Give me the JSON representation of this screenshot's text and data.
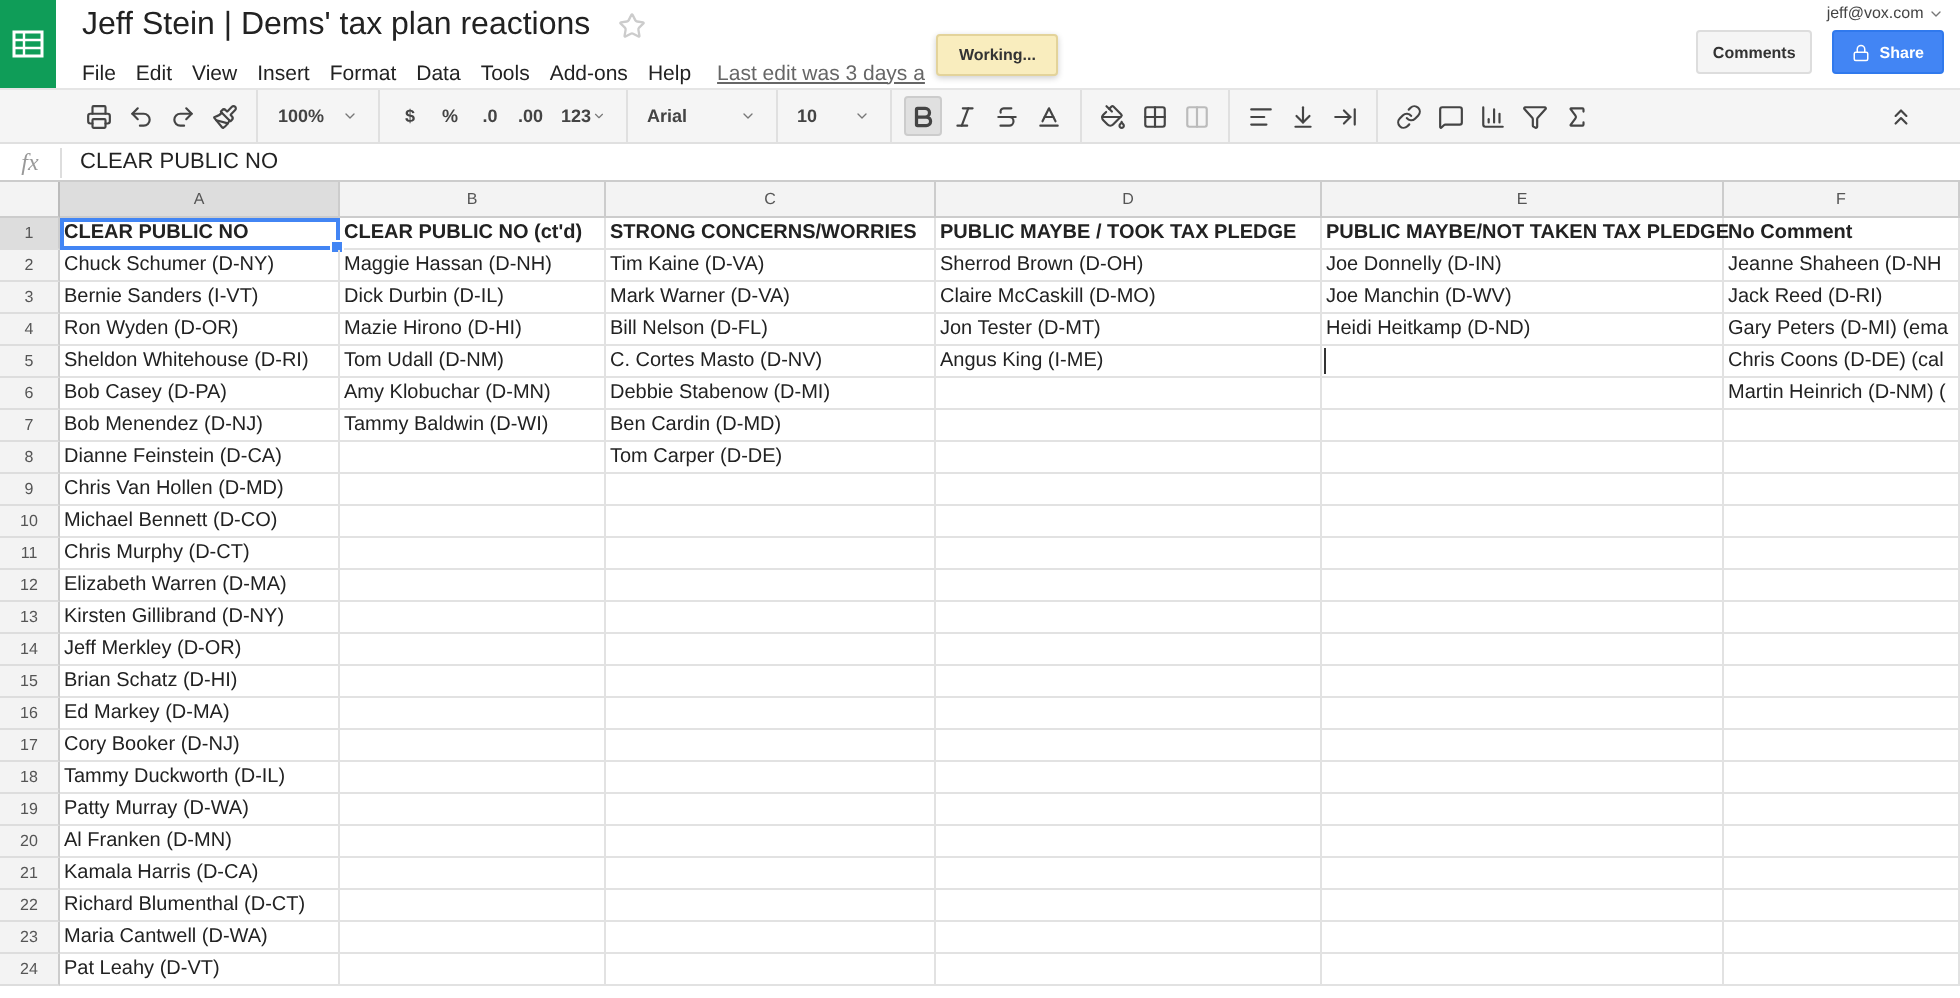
{
  "document": {
    "title": "Jeff Stein | Dems' tax plan reactions",
    "starred": false
  },
  "account": {
    "email": "jeff@vox.com"
  },
  "menu": [
    "File",
    "Edit",
    "View",
    "Insert",
    "Format",
    "Data",
    "Tools",
    "Add-ons",
    "Help"
  ],
  "last_edit": "Last edit was 3 days a",
  "toast": "Working...",
  "buttons": {
    "comments": "Comments",
    "share": "Share"
  },
  "toolbar": {
    "zoom": "100%",
    "currency": "$",
    "percent": "%",
    "decimal_less": ".0",
    "decimal_more": ".00",
    "format": "123",
    "font": "Arial",
    "font_size": "10",
    "bold_active": true
  },
  "formula_bar": {
    "label": "fx",
    "value": "CLEAR PUBLIC NO"
  },
  "columns": [
    {
      "label": "A",
      "selected": true
    },
    {
      "label": "B",
      "selected": false
    },
    {
      "label": "C",
      "selected": false
    },
    {
      "label": "D",
      "selected": false
    },
    {
      "label": "E",
      "selected": false
    },
    {
      "label": "F",
      "selected": false
    }
  ],
  "rows": [
    {
      "number": "1",
      "selected": true,
      "header": true,
      "cells": [
        "CLEAR PUBLIC NO",
        "CLEAR PUBLIC NO (ct'd)",
        "STRONG CONCERNS/WORRIES",
        "PUBLIC MAYBE / TOOK TAX PLEDGE",
        "PUBLIC MAYBE/NOT TAKEN TAX PLEDGE",
        "No Comment"
      ]
    },
    {
      "number": "2",
      "selected": false,
      "header": false,
      "cells": [
        "Chuck Schumer (D-NY)",
        "Maggie Hassan (D-NH)",
        "Tim Kaine (D-VA)",
        "Sherrod Brown (D-OH)",
        "Joe Donnelly (D-IN)",
        "Jeanne Shaheen (D-NH"
      ]
    },
    {
      "number": "3",
      "selected": false,
      "header": false,
      "cells": [
        "Bernie Sanders (I-VT)",
        "Dick Durbin (D-IL)",
        "Mark Warner (D-VA)",
        "Claire McCaskill (D-MO)",
        "Joe Manchin (D-WV)",
        "Jack Reed (D-RI)"
      ]
    },
    {
      "number": "4",
      "selected": false,
      "header": false,
      "cells": [
        "Ron Wyden (D-OR)",
        "Mazie Hirono (D-HI)",
        "Bill Nelson (D-FL)",
        "Jon Tester (D-MT)",
        "Heidi Heitkamp (D-ND)",
        "Gary Peters (D-MI) (ema"
      ]
    },
    {
      "number": "5",
      "selected": false,
      "header": false,
      "cells": [
        "Sheldon Whitehouse (D-RI)",
        "Tom Udall (D-NM)",
        "C. Cortes Masto (D-NV)",
        "Angus King (I-ME)",
        "",
        "Chris Coons (D-DE) (cal"
      ]
    },
    {
      "number": "6",
      "selected": false,
      "header": false,
      "cells": [
        "Bob Casey (D-PA)",
        "Amy Klobuchar (D-MN)",
        "Debbie Stabenow (D-MI)",
        "",
        "",
        "Martin Heinrich (D-NM) ("
      ]
    },
    {
      "number": "7",
      "selected": false,
      "header": false,
      "cells": [
        "Bob Menendez (D-NJ)",
        "Tammy Baldwin (D-WI)",
        "Ben Cardin (D-MD)",
        "",
        "",
        ""
      ]
    },
    {
      "number": "8",
      "selected": false,
      "header": false,
      "cells": [
        "Dianne Feinstein (D-CA)",
        "",
        "Tom Carper (D-DE)",
        "",
        "",
        ""
      ]
    },
    {
      "number": "9",
      "selected": false,
      "header": false,
      "cells": [
        "Chris Van Hollen (D-MD)",
        "",
        "",
        "",
        "",
        ""
      ]
    },
    {
      "number": "10",
      "selected": false,
      "header": false,
      "cells": [
        "Michael Bennett (D-CO)",
        "",
        "",
        "",
        "",
        ""
      ]
    },
    {
      "number": "11",
      "selected": false,
      "header": false,
      "cells": [
        "Chris Murphy (D-CT)",
        "",
        "",
        "",
        "",
        ""
      ]
    },
    {
      "number": "12",
      "selected": false,
      "header": false,
      "cells": [
        "Elizabeth Warren (D-MA)",
        "",
        "",
        "",
        "",
        ""
      ]
    },
    {
      "number": "13",
      "selected": false,
      "header": false,
      "cells": [
        "Kirsten Gillibrand (D-NY)",
        "",
        "",
        "",
        "",
        ""
      ]
    },
    {
      "number": "14",
      "selected": false,
      "header": false,
      "cells": [
        "Jeff Merkley (D-OR)",
        "",
        "",
        "",
        "",
        ""
      ]
    },
    {
      "number": "15",
      "selected": false,
      "header": false,
      "cells": [
        "Brian Schatz (D-HI)",
        "",
        "",
        "",
        "",
        ""
      ]
    },
    {
      "number": "16",
      "selected": false,
      "header": false,
      "cells": [
        "Ed Markey (D-MA)",
        "",
        "",
        "",
        "",
        ""
      ]
    },
    {
      "number": "17",
      "selected": false,
      "header": false,
      "cells": [
        "Cory Booker (D-NJ)",
        "",
        "",
        "",
        "",
        ""
      ]
    },
    {
      "number": "18",
      "selected": false,
      "header": false,
      "cells": [
        "Tammy Duckworth (D-IL)",
        "",
        "",
        "",
        "",
        ""
      ]
    },
    {
      "number": "19",
      "selected": false,
      "header": false,
      "cells": [
        "Patty Murray (D-WA)",
        "",
        "",
        "",
        "",
        ""
      ]
    },
    {
      "number": "20",
      "selected": false,
      "header": false,
      "cells": [
        "Al Franken (D-MN)",
        "",
        "",
        "",
        "",
        ""
      ]
    },
    {
      "number": "21",
      "selected": false,
      "header": false,
      "cells": [
        "Kamala Harris (D-CA)",
        "",
        "",
        "",
        "",
        ""
      ]
    },
    {
      "number": "22",
      "selected": false,
      "header": false,
      "cells": [
        "Richard Blumenthal (D-CT)",
        "",
        "",
        "",
        "",
        ""
      ]
    },
    {
      "number": "23",
      "selected": false,
      "header": false,
      "cells": [
        "Maria Cantwell (D-WA)",
        "",
        "",
        "",
        "",
        ""
      ]
    },
    {
      "number": "24",
      "selected": false,
      "header": false,
      "cells": [
        "Pat Leahy (D-VT)",
        "",
        "",
        "",
        "",
        ""
      ]
    }
  ]
}
